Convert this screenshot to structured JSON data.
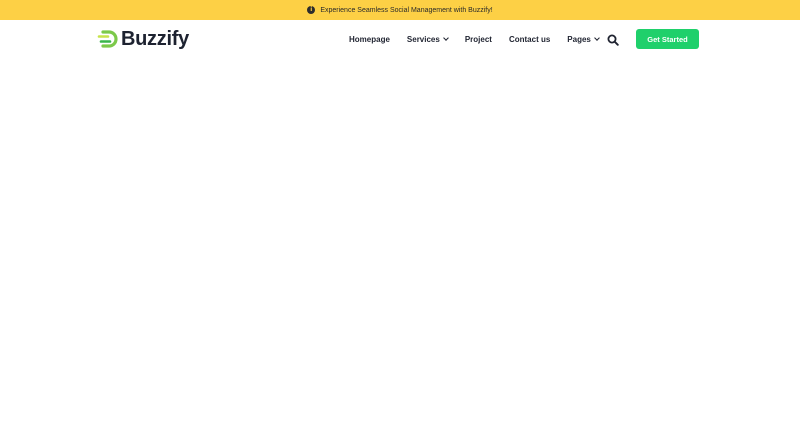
{
  "announcement": {
    "icon": "info-icon",
    "text": "Experience Seamless Social Management with Buzzify!"
  },
  "logo": {
    "text": "Buzzify",
    "icon": "buzzify-logo-icon"
  },
  "nav": {
    "items": [
      {
        "label": "Homepage",
        "has_dropdown": false
      },
      {
        "label": "Services",
        "has_dropdown": true
      },
      {
        "label": "Project",
        "has_dropdown": false
      },
      {
        "label": "Contact us",
        "has_dropdown": false
      },
      {
        "label": "Pages",
        "has_dropdown": true
      }
    ],
    "search_icon": "search-icon"
  },
  "cta": {
    "label": "Get Started"
  },
  "colors": {
    "announcement_bg": "#fdd045",
    "cta_bg": "#1fd06b",
    "logo_green": "#7cc94a",
    "text_dark": "#1f2330"
  }
}
